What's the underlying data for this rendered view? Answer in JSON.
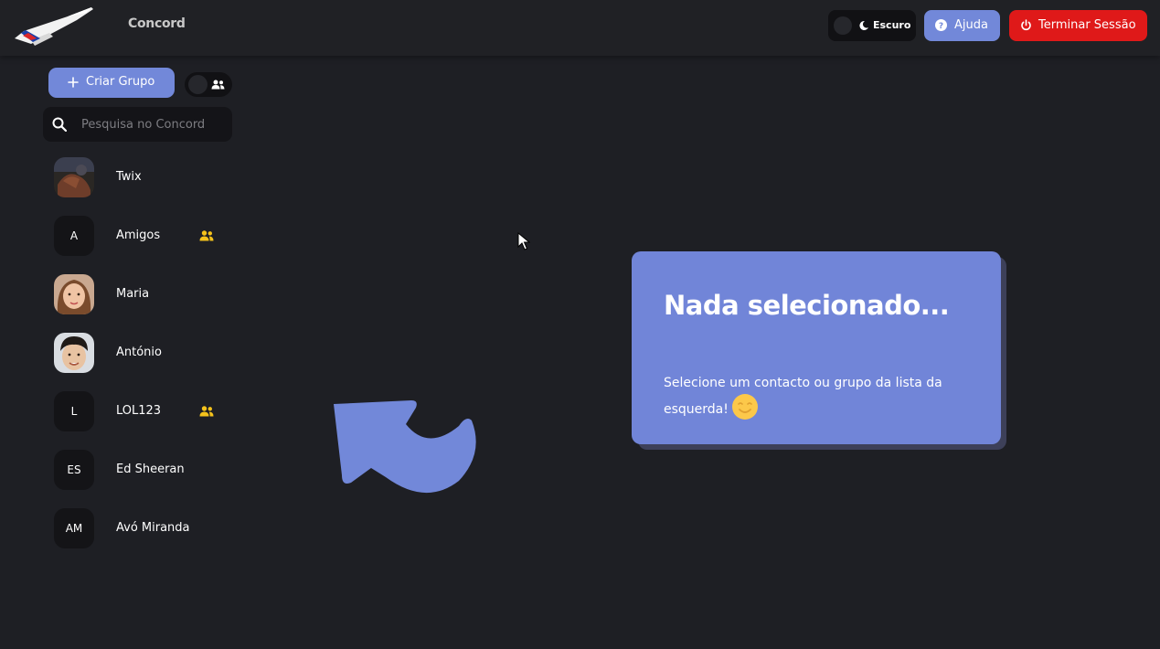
{
  "header": {
    "app_name": "Concord",
    "theme_label": "Escuro",
    "help_label": "Ajuda",
    "logout_label": "Terminar Sessão"
  },
  "sidebar": {
    "create_group_label": "Criar Grupo",
    "search_placeholder": "Pesquisa no Concord",
    "contacts": [
      {
        "initials": "",
        "name": "Twix",
        "is_group": false,
        "avatar": "photo"
      },
      {
        "initials": "A",
        "name": "Amigos",
        "is_group": true
      },
      {
        "initials": "",
        "name": "Maria",
        "is_group": false,
        "avatar": "photo"
      },
      {
        "initials": "",
        "name": "António",
        "is_group": false,
        "avatar": "photo"
      },
      {
        "initials": "L",
        "name": "LOL123",
        "is_group": true
      },
      {
        "initials": "ES",
        "name": "Ed Sheeran",
        "is_group": false
      },
      {
        "initials": "AM",
        "name": "Avó Miranda",
        "is_group": false
      }
    ]
  },
  "empty_state": {
    "title": "Nada selecionado...",
    "message": "Selecione um contacto ou grupo da lista da esquerda!"
  },
  "colors": {
    "background": "#1e1f24",
    "accent": "#7288d9",
    "danger": "#df1919",
    "group_icon": "#f4c21b"
  },
  "icons": {
    "logo": "concorde-airplane-logo",
    "theme": "moon-icon",
    "help": "question-circle-icon",
    "logout": "power-icon",
    "create": "plus-icon",
    "group_toggle": "users-icon",
    "search": "search-icon",
    "hint": "curved-arrow-icon",
    "emoji": "wink-emoji-icon"
  }
}
